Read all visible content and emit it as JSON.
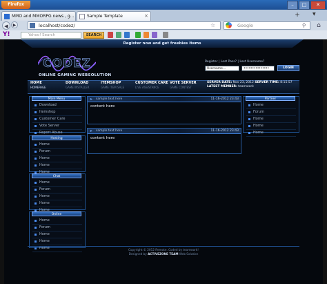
{
  "browser": {
    "button_label": "Firefox",
    "tabs": [
      {
        "label": "MMO and MMORPG news , g..."
      },
      {
        "label": "Sample Template"
      }
    ],
    "url": "localhost/codez/",
    "search_placeholder": "Google",
    "yahoo_search_placeholder": "Yahoo! Search",
    "yahoo_search_button": "SEARCH",
    "yahoo_logo": "Y!"
  },
  "site": {
    "banner": "Register now and get freebies items",
    "logo_text": "CODEZ",
    "logo_subtitle": "ONLINE GAMING WEBSOLUTION",
    "login": {
      "links": "Register | Lost Pass? | Lost Username?",
      "username": "Username...",
      "password": "•••••••••••••••",
      "button": "LOGIN"
    },
    "menu": [
      {
        "title": "HOME",
        "sub": "HOMEPAGE"
      },
      {
        "title": "DOWNLOAD",
        "sub": "GAME INSTALLER"
      },
      {
        "title": "ITEMSHOP",
        "sub": "GAME ITEM SALE"
      },
      {
        "title": "CUSTOMER CARE",
        "sub": "LIVE ASSISTANCE"
      },
      {
        "title": "VOTE SERVER",
        "sub": "GAME CONTEST"
      }
    ],
    "server": {
      "date_label": "SERVER DATE:",
      "date_value": "Nov 23, 2012",
      "time_label": "SERVER TIME:",
      "time_value": "8:15:57",
      "member_label": "LATEST MEMBER:",
      "member_value": "teamwork"
    },
    "left_boxes": [
      {
        "title": "Main Menu",
        "items": [
          "Download",
          "Itemshop",
          "Customer Care",
          "Vote Server",
          "Report Abuse"
        ]
      },
      {
        "title": "Hosting",
        "items": [
          "Home",
          "Forum",
          "Home",
          "Home",
          "Home"
        ]
      },
      {
        "title": "Chat",
        "items": [
          "Home",
          "Forum",
          "Home",
          "Home",
          "Home"
        ]
      },
      {
        "title": "Online",
        "items": [
          "Home",
          "Forum",
          "Home",
          "Home",
          "Home"
        ]
      }
    ],
    "right_box": {
      "title": "Partner",
      "items": [
        "Home",
        "Forum",
        "Home",
        "Home",
        "Home"
      ]
    },
    "posts": [
      {
        "title": "sample text here",
        "date": "11-16-2012 23:43",
        "body": "content here"
      },
      {
        "title": "sample text here",
        "date": "11-16-2012 23:43",
        "body": "content here"
      }
    ],
    "footer": {
      "line1": "Copyright © 2012 Remote. Coded by teamwork!",
      "line2_pre": "Designed by",
      "line2_team": "ACTIVEZONE TEAM",
      "line2_post": "Web Solution"
    }
  },
  "colors": {
    "accent": "#3f7fd8",
    "page_bg": "#05080d",
    "logo_wave": "#9b5cff"
  }
}
